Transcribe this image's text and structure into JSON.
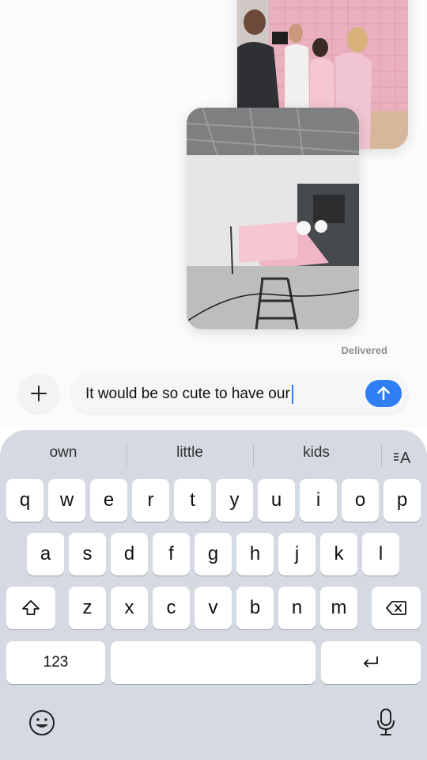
{
  "conversation": {
    "status": "Delivered"
  },
  "composer": {
    "text": "It would be so cute to have our"
  },
  "keyboard": {
    "suggestions": [
      "own",
      "little",
      "kids"
    ],
    "row1": [
      "q",
      "w",
      "e",
      "r",
      "t",
      "y",
      "u",
      "i",
      "o",
      "p"
    ],
    "row2": [
      "a",
      "s",
      "d",
      "f",
      "g",
      "h",
      "j",
      "k",
      "l"
    ],
    "row3": [
      "z",
      "x",
      "c",
      "v",
      "b",
      "n",
      "m"
    ],
    "numbers_label": "123"
  },
  "icons": {
    "attach": "plus-icon",
    "send": "arrow-up-icon",
    "format": "text-format-icon",
    "shift": "shift-icon",
    "delete": "backspace-icon",
    "return": "return-icon",
    "emoji": "emoji-icon",
    "dictation": "microphone-icon"
  },
  "colors": {
    "accent": "#2f7ef6",
    "keyboard_bg": "#d5d9e2",
    "key_bg": "#ffffff"
  }
}
